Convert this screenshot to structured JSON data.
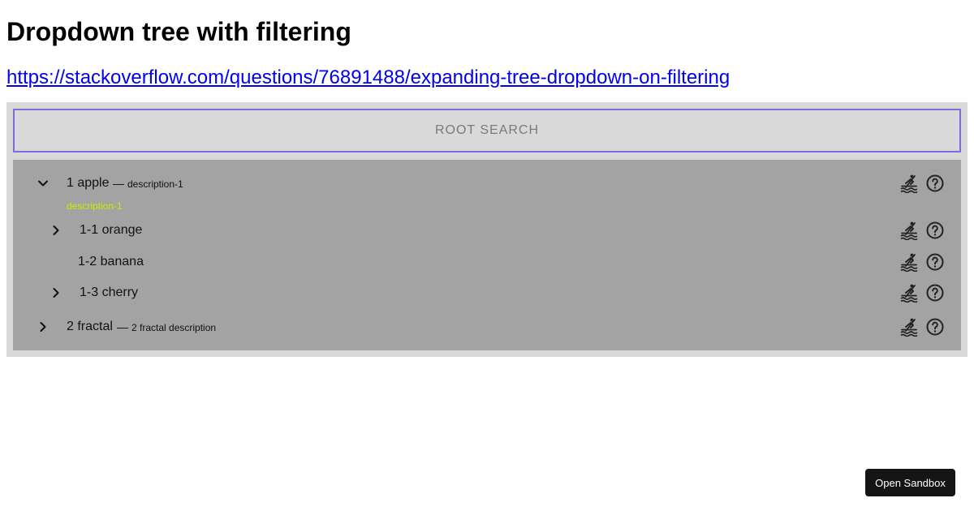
{
  "page": {
    "title": "Dropdown tree with filtering",
    "link_text": "https://stackoverflow.com/questions/76891488/expanding-tree-dropdown-on-filtering"
  },
  "search": {
    "placeholder": "ROOT SEARCH"
  },
  "tree": {
    "separator": "—",
    "nodes": [
      {
        "label": "1 apple",
        "description": "description-1",
        "expanded_description": "description-1",
        "state": "expanded"
      },
      {
        "label": "1-1 orange",
        "state": "collapsed"
      },
      {
        "label": "1-2 banana",
        "state": "leaf"
      },
      {
        "label": "1-3 cherry",
        "state": "collapsed"
      },
      {
        "label": "2 fractal",
        "description": "2 fractal description",
        "state": "collapsed"
      }
    ]
  },
  "icons": {
    "row_action_1": "kayak-icon",
    "row_action_2": "help-circle-icon",
    "expanded": "chevron-down-icon",
    "collapsed": "chevron-right-icon"
  },
  "colors": {
    "search_border": "#7b6fd6",
    "tree_background": "#a3a3a3",
    "container_background": "#d9d9d9",
    "expanded_description": "#c4f000",
    "link": "#0000ee"
  },
  "sandbox": {
    "label": "Open Sandbox"
  }
}
